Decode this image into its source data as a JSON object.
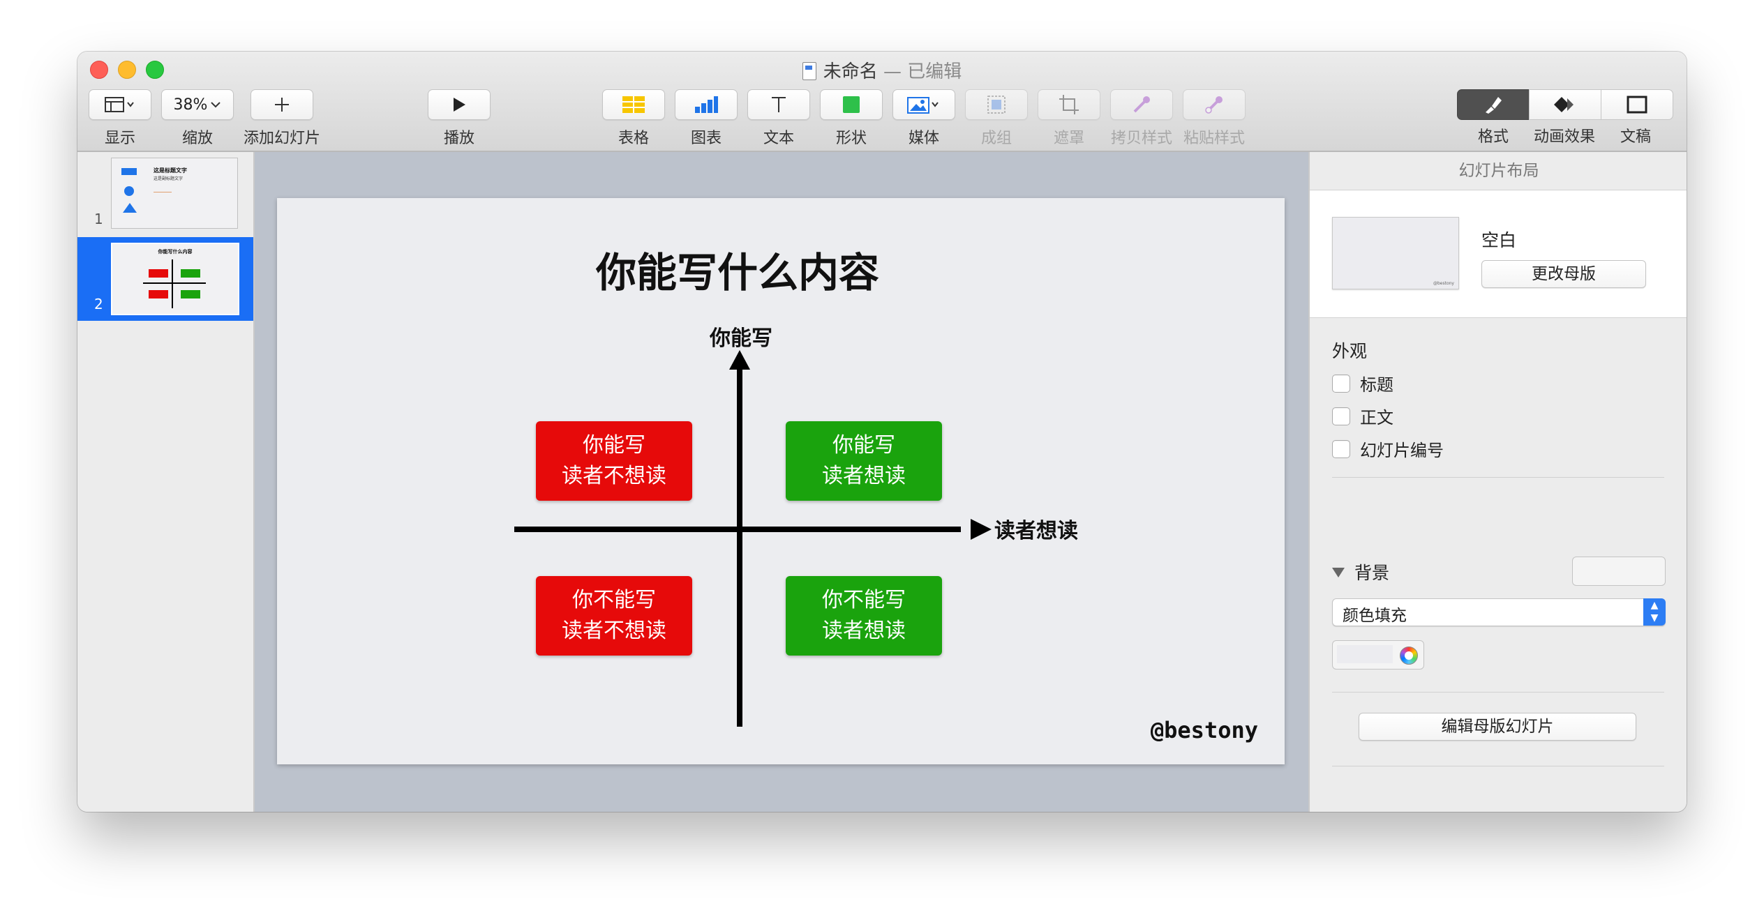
{
  "window": {
    "title": "未命名",
    "title_suffix": " — 已编辑"
  },
  "toolbar": {
    "view_label": "显示",
    "zoom_value": "38%",
    "zoom_label": "缩放",
    "add_slide_label": "添加幻灯片",
    "play_label": "播放",
    "table_label": "表格",
    "chart_label": "图表",
    "text_label": "文本",
    "shape_label": "形状",
    "media_label": "媒体",
    "group_label": "成组",
    "mask_label": "遮罩",
    "copy_style_label": "拷贝样式",
    "paste_style_label": "粘贴样式",
    "format_label": "格式",
    "animate_label": "动画效果",
    "document_label": "文稿"
  },
  "navigator": {
    "slides": [
      {
        "number": "1",
        "title": "这是标题文字",
        "subtitle": "这是副标题文字"
      },
      {
        "number": "2",
        "title": "你能写什么内容"
      }
    ]
  },
  "slide": {
    "title": "你能写什么内容",
    "y_axis_label": "你能写",
    "x_axis_label": "读者想读",
    "quadrants": {
      "top_left": {
        "line1": "你能写",
        "line2": "读者不想读",
        "color": "#e60a0a"
      },
      "top_right": {
        "line1": "你能写",
        "line2": "读者想读",
        "color": "#1aa30d"
      },
      "bottom_left": {
        "line1": "你不能写",
        "line2": "读者不想读",
        "color": "#e60a0a"
      },
      "bottom_right": {
        "line1": "你不能写",
        "line2": "读者想读",
        "color": "#1aa30d"
      }
    },
    "watermark": "@bestony"
  },
  "inspector": {
    "header": "幻灯片布局",
    "master_name": "空白",
    "change_master_button": "更改母版",
    "appearance_title": "外观",
    "options": [
      {
        "label": "标题",
        "checked": false
      },
      {
        "label": "正文",
        "checked": false
      },
      {
        "label": "幻灯片编号",
        "checked": false
      }
    ],
    "background_title": "背景",
    "fill_type": "颜色填充",
    "edit_master_button": "编辑母版幻灯片"
  },
  "colors": {
    "selection": "#1a6ef5",
    "red": "#e60a0a",
    "green": "#1aa30d",
    "canvas_bg": "#bcc2cc"
  }
}
